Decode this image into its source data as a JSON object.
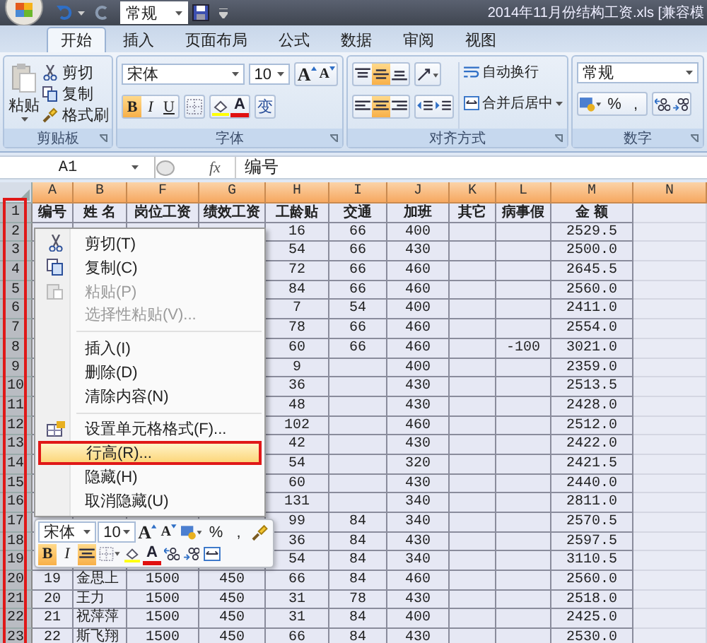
{
  "title_bar": {
    "quick_format": "常规",
    "title": "2014年11月份结构工资.xls  [兼容模"
  },
  "ribbon_tabs": [
    {
      "label": "开始",
      "selected": true
    },
    {
      "label": "插入",
      "selected": false
    },
    {
      "label": "页面布局",
      "selected": false
    },
    {
      "label": "公式",
      "selected": false
    },
    {
      "label": "数据",
      "selected": false
    },
    {
      "label": "审阅",
      "selected": false
    },
    {
      "label": "视图",
      "selected": false
    }
  ],
  "ribbon": {
    "clipboard": {
      "paste": "粘贴",
      "cut": "剪切",
      "copy": "复制",
      "format_painter": "格式刷",
      "group": "剪贴板"
    },
    "font": {
      "font_name": "宋体",
      "font_size": "10",
      "grow": "A",
      "shrink": "A",
      "bold": "B",
      "italic": "I",
      "underline": "U",
      "font_color": "A",
      "phonetic": "变",
      "bold_active": true,
      "group": "字体"
    },
    "alignment": {
      "middle_active": true,
      "center_active": true,
      "wrap_text": "自动换行",
      "merge_center": "合并后居中",
      "group": "对齐方式"
    },
    "number": {
      "format": "常规",
      "percent": "%",
      "comma": ",",
      "group": "数字"
    }
  },
  "formula_bar": {
    "name_box": "A1",
    "fx": "fx",
    "value": "编号"
  },
  "sheet": {
    "columns": [
      "A",
      "B",
      "F",
      "G",
      "H",
      "I",
      "J",
      "K",
      "L",
      "M",
      "N"
    ],
    "rows": [
      {
        "number": "1",
        "selected": true,
        "kind": "header",
        "cells": [
          "编号",
          "姓 名",
          "岗位工资",
          "绩效工资",
          "工龄贴",
          "交通",
          "加班",
          "其它",
          "病事假",
          "金 额",
          null
        ]
      },
      {
        "number": "2",
        "selected": true,
        "kind": "data",
        "cells": [
          null,
          null,
          null,
          null,
          "16",
          "66",
          "400",
          null,
          null,
          "2529.5",
          null
        ]
      },
      {
        "number": "3",
        "selected": true,
        "kind": "data",
        "cells": [
          null,
          null,
          null,
          null,
          "54",
          "66",
          "430",
          null,
          null,
          "2500.0",
          null
        ]
      },
      {
        "number": "4",
        "selected": true,
        "kind": "data",
        "cells": [
          null,
          null,
          null,
          null,
          "72",
          "66",
          "460",
          null,
          null,
          "2645.5",
          null
        ]
      },
      {
        "number": "5",
        "selected": true,
        "kind": "data",
        "cells": [
          null,
          null,
          null,
          null,
          "84",
          "66",
          "460",
          null,
          null,
          "2560.0",
          null
        ]
      },
      {
        "number": "6",
        "selected": true,
        "kind": "data",
        "cells": [
          null,
          null,
          null,
          null,
          "7",
          "54",
          "400",
          null,
          null,
          "2411.0",
          null
        ]
      },
      {
        "number": "7",
        "selected": true,
        "kind": "data",
        "cells": [
          null,
          null,
          null,
          null,
          "78",
          "66",
          "460",
          null,
          null,
          "2554.0",
          null
        ]
      },
      {
        "number": "8",
        "selected": true,
        "kind": "data",
        "cells": [
          null,
          null,
          null,
          null,
          "60",
          "66",
          "460",
          null,
          "-100",
          "3021.0",
          null
        ]
      },
      {
        "number": "9",
        "selected": true,
        "kind": "data",
        "cells": [
          null,
          null,
          null,
          null,
          "9",
          null,
          "400",
          null,
          null,
          "2359.0",
          null
        ]
      },
      {
        "number": "10",
        "selected": true,
        "kind": "data",
        "cells": [
          null,
          null,
          null,
          null,
          "36",
          null,
          "430",
          null,
          null,
          "2513.5",
          null
        ]
      },
      {
        "number": "11",
        "selected": true,
        "kind": "data",
        "cells": [
          null,
          null,
          null,
          null,
          "48",
          null,
          "430",
          null,
          null,
          "2428.0",
          null
        ]
      },
      {
        "number": "12",
        "selected": true,
        "kind": "data",
        "cells": [
          null,
          null,
          null,
          null,
          "102",
          null,
          "460",
          null,
          null,
          "2512.0",
          null
        ]
      },
      {
        "number": "13",
        "selected": true,
        "kind": "data",
        "cells": [
          null,
          null,
          null,
          null,
          "42",
          null,
          "430",
          null,
          null,
          "2422.0",
          null
        ]
      },
      {
        "number": "14",
        "selected": true,
        "kind": "data",
        "cells": [
          null,
          null,
          null,
          null,
          "54",
          null,
          "320",
          null,
          null,
          "2421.5",
          null
        ]
      },
      {
        "number": "15",
        "selected": true,
        "kind": "data",
        "cells": [
          null,
          null,
          null,
          null,
          "60",
          null,
          "430",
          null,
          null,
          "2440.0",
          null
        ]
      },
      {
        "number": "16",
        "selected": true,
        "kind": "data",
        "cells": [
          null,
          null,
          null,
          null,
          "131",
          null,
          "340",
          null,
          null,
          "2811.0",
          null
        ]
      },
      {
        "number": "17",
        "selected": true,
        "kind": "data",
        "cells": [
          null,
          null,
          null,
          null,
          "99",
          "84",
          "340",
          null,
          null,
          "2570.5",
          null
        ]
      },
      {
        "number": "18",
        "selected": true,
        "kind": "data",
        "cells": [
          null,
          null,
          null,
          null,
          "36",
          "84",
          "430",
          null,
          null,
          "2597.5",
          null
        ]
      },
      {
        "number": "19",
        "selected": true,
        "kind": "data",
        "cells": [
          null,
          null,
          null,
          null,
          "54",
          "84",
          "340",
          null,
          null,
          "3110.5",
          null
        ]
      },
      {
        "number": "20",
        "selected": true,
        "kind": "data",
        "cells": [
          "19",
          "金思上",
          "1500",
          "450",
          "66",
          "84",
          "460",
          null,
          null,
          "2560.0",
          null
        ]
      },
      {
        "number": "21",
        "selected": true,
        "kind": "data",
        "cells": [
          "20",
          "王力",
          "1500",
          "450",
          "31",
          "78",
          "430",
          null,
          null,
          "2518.0",
          null
        ]
      },
      {
        "number": "22",
        "selected": true,
        "kind": "data",
        "cells": [
          "21",
          "祝萍萍",
          "1500",
          "450",
          "31",
          "84",
          "400",
          null,
          null,
          "2425.0",
          null
        ]
      },
      {
        "number": "23",
        "selected": true,
        "kind": "data",
        "cells": [
          "22",
          "斯飞翔",
          "1500",
          "450",
          "66",
          "84",
          "430",
          null,
          null,
          "2530.0",
          null
        ]
      }
    ]
  },
  "context_menu": {
    "groups": [
      {
        "items": [
          {
            "label": "剪切(T)",
            "kind": "cut",
            "disabled": false,
            "selected": false
          },
          {
            "label": "复制(C)",
            "kind": "copy",
            "disabled": false,
            "selected": false
          },
          {
            "label": "粘贴(P)",
            "kind": "paste",
            "disabled": true,
            "selected": false
          },
          {
            "label": "选择性粘贴(V)...",
            "kind": "plain",
            "disabled": true,
            "selected": false
          }
        ]
      },
      {
        "items": [
          {
            "label": "插入(I)",
            "kind": "plain",
            "disabled": false,
            "selected": false
          },
          {
            "label": "删除(D)",
            "kind": "plain",
            "disabled": false,
            "selected": false
          },
          {
            "label": "清除内容(N)",
            "kind": "plain",
            "disabled": false,
            "selected": false
          }
        ]
      },
      {
        "items": [
          {
            "label": "设置单元格格式(F)...",
            "kind": "format",
            "disabled": false,
            "selected": false
          },
          {
            "label": "行高(R)...",
            "kind": "plain",
            "disabled": false,
            "selected": true
          },
          {
            "label": "隐藏(H)",
            "kind": "plain",
            "disabled": false,
            "selected": false
          },
          {
            "label": "取消隐藏(U)",
            "kind": "plain",
            "disabled": false,
            "selected": false
          }
        ]
      }
    ]
  },
  "mini_toolbar": {
    "font_name": "宋体",
    "font_size": "10",
    "grow": "A",
    "shrink": "A",
    "percent": "%",
    "comma": ",",
    "bold": "B",
    "italic": "I",
    "font_color": "A",
    "bold_active": true,
    "center_active": true
  }
}
